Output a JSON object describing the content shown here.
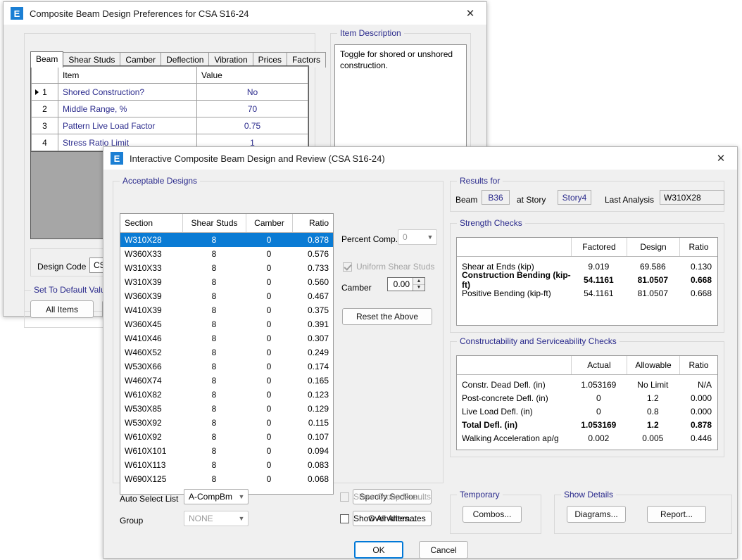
{
  "prefs_window": {
    "title": "Composite Beam Design Preferences for CSA S16-24",
    "icon": "E",
    "close_icon": "✕",
    "tabs": [
      {
        "label": "Beam",
        "active": true
      },
      {
        "label": "Shear Studs",
        "active": false
      },
      {
        "label": "Camber",
        "active": false
      },
      {
        "label": "Deflection",
        "active": false
      },
      {
        "label": "Vibration",
        "active": false
      },
      {
        "label": "Prices",
        "active": false
      },
      {
        "label": "Factors",
        "active": false
      }
    ],
    "grid": {
      "headers": [
        "",
        "Item",
        "Value"
      ],
      "rows": [
        {
          "num": "1",
          "item": "Shored Construction?",
          "value": "No",
          "current": true
        },
        {
          "num": "2",
          "item": "Middle Range, %",
          "value": "70",
          "current": false
        },
        {
          "num": "3",
          "item": "Pattern Live Load Factor",
          "value": "0.75",
          "current": false
        },
        {
          "num": "4",
          "item": "Stress Ratio Limit",
          "value": "1",
          "current": false
        }
      ]
    },
    "design_code_label": "Design Code",
    "design_code_value": "CSA",
    "defaults_group_label": "Set To Default Values",
    "all_items_button": "All Items",
    "item_description_label": "Item Description",
    "item_description_text": "Toggle for shored or unshored construction."
  },
  "review_window": {
    "title": "Interactive Composite Beam Design and Review (CSA S16-24)",
    "icon": "E",
    "close_icon": "✕",
    "acceptable_designs": {
      "group_label": "Acceptable Designs",
      "headers": [
        "Section",
        "Shear Studs",
        "Camber",
        "Ratio"
      ],
      "rows": [
        {
          "section": "W310X28",
          "studs": "8",
          "camber": "0",
          "ratio": "0.878",
          "selected": true
        },
        {
          "section": "W360X33",
          "studs": "8",
          "camber": "0",
          "ratio": "0.576",
          "selected": false
        },
        {
          "section": "W310X33",
          "studs": "8",
          "camber": "0",
          "ratio": "0.733",
          "selected": false
        },
        {
          "section": "W310X39",
          "studs": "8",
          "camber": "0",
          "ratio": "0.560",
          "selected": false
        },
        {
          "section": "W360X39",
          "studs": "8",
          "camber": "0",
          "ratio": "0.467",
          "selected": false
        },
        {
          "section": "W410X39",
          "studs": "8",
          "camber": "0",
          "ratio": "0.375",
          "selected": false
        },
        {
          "section": "W360X45",
          "studs": "8",
          "camber": "0",
          "ratio": "0.391",
          "selected": false
        },
        {
          "section": "W410X46",
          "studs": "8",
          "camber": "0",
          "ratio": "0.307",
          "selected": false
        },
        {
          "section": "W460X52",
          "studs": "8",
          "camber": "0",
          "ratio": "0.249",
          "selected": false
        },
        {
          "section": "W530X66",
          "studs": "8",
          "camber": "0",
          "ratio": "0.174",
          "selected": false
        },
        {
          "section": "W460X74",
          "studs": "8",
          "camber": "0",
          "ratio": "0.165",
          "selected": false
        },
        {
          "section": "W610X82",
          "studs": "8",
          "camber": "0",
          "ratio": "0.123",
          "selected": false
        },
        {
          "section": "W530X85",
          "studs": "8",
          "camber": "0",
          "ratio": "0.129",
          "selected": false
        },
        {
          "section": "W530X92",
          "studs": "8",
          "camber": "0",
          "ratio": "0.115",
          "selected": false
        },
        {
          "section": "W610X92",
          "studs": "8",
          "camber": "0",
          "ratio": "0.107",
          "selected": false
        },
        {
          "section": "W610X101",
          "studs": "8",
          "camber": "0",
          "ratio": "0.094",
          "selected": false
        },
        {
          "section": "W610X113",
          "studs": "8",
          "camber": "0",
          "ratio": "0.083",
          "selected": false
        },
        {
          "section": "W690X125",
          "studs": "8",
          "camber": "0",
          "ratio": "0.068",
          "selected": false
        }
      ]
    },
    "controls": {
      "percent_comp_label": "Percent Comp.",
      "percent_comp_value": "0",
      "uniform_shear_studs_label": "Uniform Shear Studs",
      "uniform_shear_studs_checked": true,
      "uniform_shear_studs_disabled": true,
      "camber_label": "Camber",
      "camber_value": "0.00",
      "reset_button": "Reset the Above"
    },
    "results_for": {
      "group_label": "Results for",
      "beam_label": "Beam",
      "beam_value": "B36",
      "at_story_label": "at Story",
      "story_value": "Story4",
      "last_analysis_label": "Last Analysis",
      "last_analysis_value": "W310X28"
    },
    "strength_checks": {
      "group_label": "Strength Checks",
      "headers": [
        "",
        "Factored",
        "Design",
        "Ratio"
      ],
      "rows": [
        {
          "name": "Shear at Ends (kip)",
          "factored": "9.019",
          "design": "69.586",
          "ratio": "0.130",
          "bold": false
        },
        {
          "name": "Construction Bending (kip-ft)",
          "factored": "54.1161",
          "design": "81.0507",
          "ratio": "0.668",
          "bold": true
        },
        {
          "name": "Positive Bending (kip-ft)",
          "factored": "54.1161",
          "design": "81.0507",
          "ratio": "0.668",
          "bold": false
        }
      ]
    },
    "serviceability_checks": {
      "group_label": "Constructability and Serviceability Checks",
      "headers": [
        "",
        "Actual",
        "Allowable",
        "Ratio"
      ],
      "rows": [
        {
          "name": "Constr. Dead Defl. (in)",
          "actual": "1.053169",
          "allowable": "No Limit",
          "ratio": "N/A",
          "bold": false
        },
        {
          "name": "Post-concrete Defl. (in)",
          "actual": "0",
          "allowable": "1.2",
          "ratio": "0.000",
          "bold": false
        },
        {
          "name": "Live Load Defl. (in)",
          "actual": "0",
          "allowable": "0.8",
          "ratio": "0.000",
          "bold": false
        },
        {
          "name": "Total Defl. (in)",
          "actual": "1.053169",
          "allowable": "1.2",
          "ratio": "0.878",
          "bold": true
        },
        {
          "name": "Walking Acceleration ap/g",
          "actual": "0.002",
          "allowable": "0.005",
          "ratio": "0.446",
          "bold": false
        }
      ]
    },
    "bottom": {
      "auto_select_list_label": "Auto Select List",
      "auto_select_list_value": "A-CompBm",
      "specify_section_button": "Specify Section...",
      "show_group_results_label": "Show Group Results",
      "show_group_results_checked": false,
      "group_label": "Group",
      "group_value": "NONE",
      "overwrites_button": "Overwrites...",
      "show_all_alternates_label": "Show All Alternates",
      "show_all_alternates_checked": false
    },
    "temporary": {
      "group_label": "Temporary",
      "combos_button": "Combos..."
    },
    "show_details": {
      "group_label": "Show Details",
      "diagrams_button": "Diagrams...",
      "report_button": "Report..."
    },
    "ok_button": "OK",
    "cancel_button": "Cancel"
  },
  "colors": {
    "accent": "#0078D7",
    "selection": "#0A7BD4",
    "group_label": "#2A2A8C",
    "window_bg": "#F0F0F0"
  }
}
